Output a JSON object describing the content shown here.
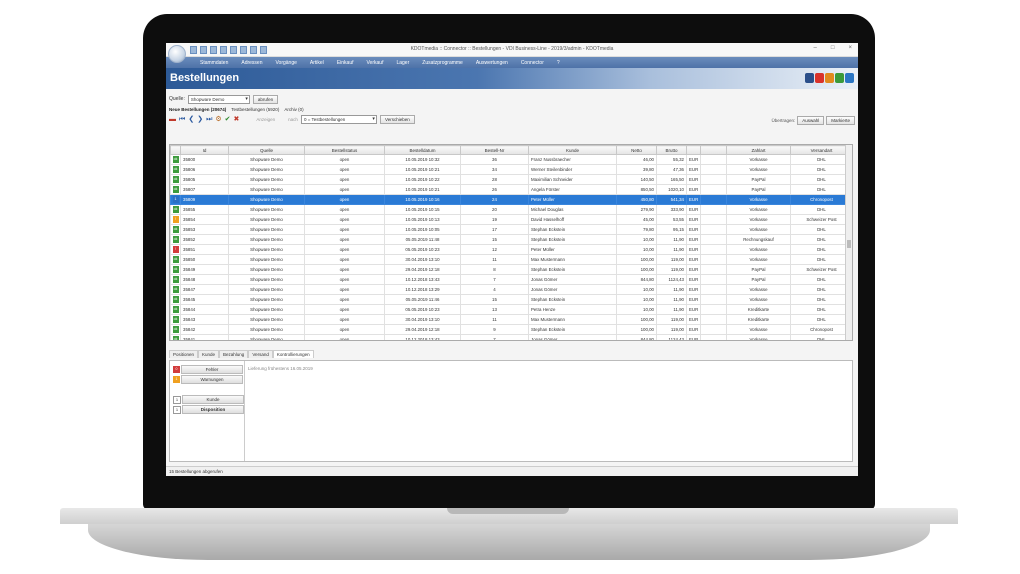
{
  "window": {
    "title": "KDOTmedia :: Connector :: Bestellungen - VDI Business-Line - 2019/3/admin - KDOTmedia",
    "minimize": "–",
    "maximize": "□",
    "close": "×"
  },
  "menu": [
    "Stammdaten",
    "Adressen",
    "Vorgänge",
    "Artikel",
    "Einkauf",
    "Verkauf",
    "Lager",
    "Zusatzprogramme",
    "Auswertungen",
    "Connector",
    "?"
  ],
  "page": {
    "title": "Bestellungen"
  },
  "logo_colors": [
    "#2b4f8a",
    "#d9332b",
    "#e08a1e",
    "#3a9a3a",
    "#2b76c4"
  ],
  "filter": {
    "label": "Quelle:",
    "value": "Shopware Demo",
    "button": "abrufen"
  },
  "tabs": [
    "Neue Bestellungen (20674)",
    "Testbestellungen (5920)",
    "Archiv (0)"
  ],
  "toolbar": {
    "icons": [
      "minus-icon",
      "first-icon",
      "prev-icon",
      "next-icon",
      "last-icon",
      "settings-icon",
      "check-icon",
      "cancel-icon"
    ],
    "search_label": "Anzeigen",
    "nach_label": "nach",
    "status_select": "0 = Testbestellungen",
    "move_button": "Verschieben",
    "uebertragen_label": "Übertragen:",
    "selected_button": "Auswahl",
    "all_button": "Markierte"
  },
  "table": {
    "headers": [
      "",
      "Id",
      "Quelle",
      "Bestellstatus",
      "Bestelldatum",
      "Bestell-Nr",
      "Kunde",
      "Netto",
      "Brutto",
      "",
      "",
      "Zahlart",
      "Versandart"
    ],
    "rows": [
      {
        "st": "g",
        "sv": "ok",
        "id": "35800",
        "q": "Shopware Demo",
        "s": "open",
        "d": "10.05.2019 10:32",
        "nr": "36",
        "k": "Franz Nussbraecher",
        "n": "46,00",
        "b": "55,32",
        "cur": "EUR",
        "z": "Vorkasse",
        "v": "DHL"
      },
      {
        "st": "g",
        "sv": "ok",
        "id": "35806",
        "q": "Shopware Demo",
        "s": "open",
        "d": "10.05.2019 10:21",
        "nr": "34",
        "k": "Werner Steilenbinder",
        "n": "39,80",
        "b": "47,36",
        "cur": "EUR",
        "z": "Vorkasse",
        "v": "DHL"
      },
      {
        "st": "g",
        "sv": "ok",
        "id": "35805",
        "q": "Shopware Demo",
        "s": "open",
        "d": "10.05.2019 10:22",
        "nr": "28",
        "k": "Maximilian Schneider",
        "n": "140,50",
        "b": "165,50",
        "cur": "EUR",
        "z": "PayPal",
        "v": "DHL"
      },
      {
        "st": "g",
        "sv": "ok",
        "id": "35807",
        "q": "Shopware Demo",
        "s": "open",
        "d": "10.05.2019 10:21",
        "nr": "26",
        "k": "Angela Förster",
        "n": "850,50",
        "b": "1020,10",
        "cur": "EUR",
        "z": "PayPal",
        "v": "DHL"
      },
      {
        "st": "b",
        "sv": "1",
        "id": "35809",
        "q": "Shopware Demo",
        "s": "open",
        "d": "10.05.2019 10:16",
        "nr": "24",
        "k": "Peter Müller",
        "n": "450,80",
        "b": "541,34",
        "cur": "EUR",
        "z": "Vorkasse",
        "v": "Chronopost",
        "sel": true
      },
      {
        "st": "g",
        "sv": "ok",
        "id": "35855",
        "q": "Shopware Demo",
        "s": "open",
        "d": "10.05.2019 10:15",
        "nr": "20",
        "k": "Michael Douglas",
        "n": "279,90",
        "b": "333,90",
        "cur": "EUR",
        "z": "Vorkasse",
        "v": "DHL"
      },
      {
        "st": "o",
        "sv": "!",
        "id": "35854",
        "q": "Shopware Demo",
        "s": "open",
        "d": "10.05.2019 10:13",
        "nr": "19",
        "k": "David Hasselhoff",
        "n": "45,00",
        "b": "53,55",
        "cur": "EUR",
        "z": "Vorkasse",
        "v": "Schweizer Post"
      },
      {
        "st": "g",
        "sv": "ok",
        "id": "35853",
        "q": "Shopware Demo",
        "s": "open",
        "d": "10.05.2019 10:05",
        "nr": "17",
        "k": "Stephan Eckstein",
        "n": "79,80",
        "b": "95,15",
        "cur": "EUR",
        "z": "Vorkasse",
        "v": "DHL"
      },
      {
        "st": "g",
        "sv": "ok",
        "id": "35852",
        "q": "Shopware Demo",
        "s": "open",
        "d": "05.05.2019 11:48",
        "nr": "15",
        "k": "Stephan Eckstein",
        "n": "10,00",
        "b": "11,90",
        "cur": "EUR",
        "z": "Rechnungskauf",
        "v": "DHL"
      },
      {
        "st": "r",
        "sv": "!",
        "id": "35851",
        "q": "Shopware Demo",
        "s": "open",
        "d": "05.05.2019 10:23",
        "nr": "12",
        "k": "Peter Müller",
        "n": "10,00",
        "b": "11,90",
        "cur": "EUR",
        "z": "Vorkasse",
        "v": "DHL"
      },
      {
        "st": "g",
        "sv": "ok",
        "id": "35850",
        "q": "Shopware Demo",
        "s": "open",
        "d": "30.04.2019 13:10",
        "nr": "11",
        "k": "Max Mustermann",
        "n": "100,00",
        "b": "119,00",
        "cur": "EUR",
        "z": "Vorkasse",
        "v": "DHL"
      },
      {
        "st": "g",
        "sv": "ok",
        "id": "35849",
        "q": "Shopware Demo",
        "s": "open",
        "d": "29.04.2019 12:18",
        "nr": "8",
        "k": "Stephan Eckstein",
        "n": "100,00",
        "b": "119,00",
        "cur": "EUR",
        "z": "PayPal",
        "v": "Schweizer Post"
      },
      {
        "st": "g",
        "sv": "ok",
        "id": "35848",
        "q": "Shopware Demo",
        "s": "open",
        "d": "10.12.2018 13:43",
        "nr": "7",
        "k": "Jonas Gömer",
        "n": "844,80",
        "b": "1124,43",
        "cur": "EUR",
        "z": "PayPal",
        "v": "DHL"
      },
      {
        "st": "g",
        "sv": "ok",
        "id": "35847",
        "q": "Shopware Demo",
        "s": "open",
        "d": "10.12.2018 13:29",
        "nr": "4",
        "k": "Jonas Gömer",
        "n": "10,00",
        "b": "11,90",
        "cur": "EUR",
        "z": "Vorkasse",
        "v": "DHL"
      },
      {
        "st": "g",
        "sv": "ok",
        "id": "35845",
        "q": "Shopware Demo",
        "s": "open",
        "d": "05.05.2019 11:46",
        "nr": "15",
        "k": "Stephan Eckstein",
        "n": "10,00",
        "b": "11,90",
        "cur": "EUR",
        "z": "Vorkasse",
        "v": "DHL"
      },
      {
        "st": "g",
        "sv": "ok",
        "id": "35844",
        "q": "Shopware Demo",
        "s": "open",
        "d": "05.05.2019 10:23",
        "nr": "13",
        "k": "Petra Henze",
        "n": "10,00",
        "b": "11,90",
        "cur": "EUR",
        "z": "Kreditkarte",
        "v": "DHL"
      },
      {
        "st": "g",
        "sv": "ok",
        "id": "35843",
        "q": "Shopware Demo",
        "s": "open",
        "d": "30.04.2019 13:10",
        "nr": "11",
        "k": "Max Mustermann",
        "n": "100,00",
        "b": "119,00",
        "cur": "EUR",
        "z": "Kreditkarte",
        "v": "DHL"
      },
      {
        "st": "g",
        "sv": "ok",
        "id": "35842",
        "q": "Shopware Demo",
        "s": "open",
        "d": "29.04.2019 12:18",
        "nr": "9",
        "k": "Stephan Eckstein",
        "n": "100,00",
        "b": "119,00",
        "cur": "EUR",
        "z": "Vorkasse",
        "v": "Chronopost"
      },
      {
        "st": "g",
        "sv": "ok",
        "id": "35841",
        "q": "Shopware Demo",
        "s": "open",
        "d": "10.12.2018 13:43",
        "nr": "7",
        "k": "Jonas Gömer",
        "n": "844,80",
        "b": "1124,43",
        "cur": "EUR",
        "z": "Vorkasse",
        "v": "DHL"
      }
    ]
  },
  "bottom_tabs": [
    "Positionen",
    "Kunde",
    "Bezahlung",
    "Versand",
    "Kontrollierungen"
  ],
  "bottom_panel": {
    "fehler_count": "0",
    "fehler_label": "Fehler",
    "warnungen_count": "1",
    "warnungen_label": "Warnungen",
    "kunde_count": "1",
    "kunde_label": "Kunde",
    "dispo_count": "1",
    "dispo_label": "Disposition",
    "info": "Lieferung frühestens 16.05.2019"
  },
  "status": "15 Bestellungen abgerufen"
}
